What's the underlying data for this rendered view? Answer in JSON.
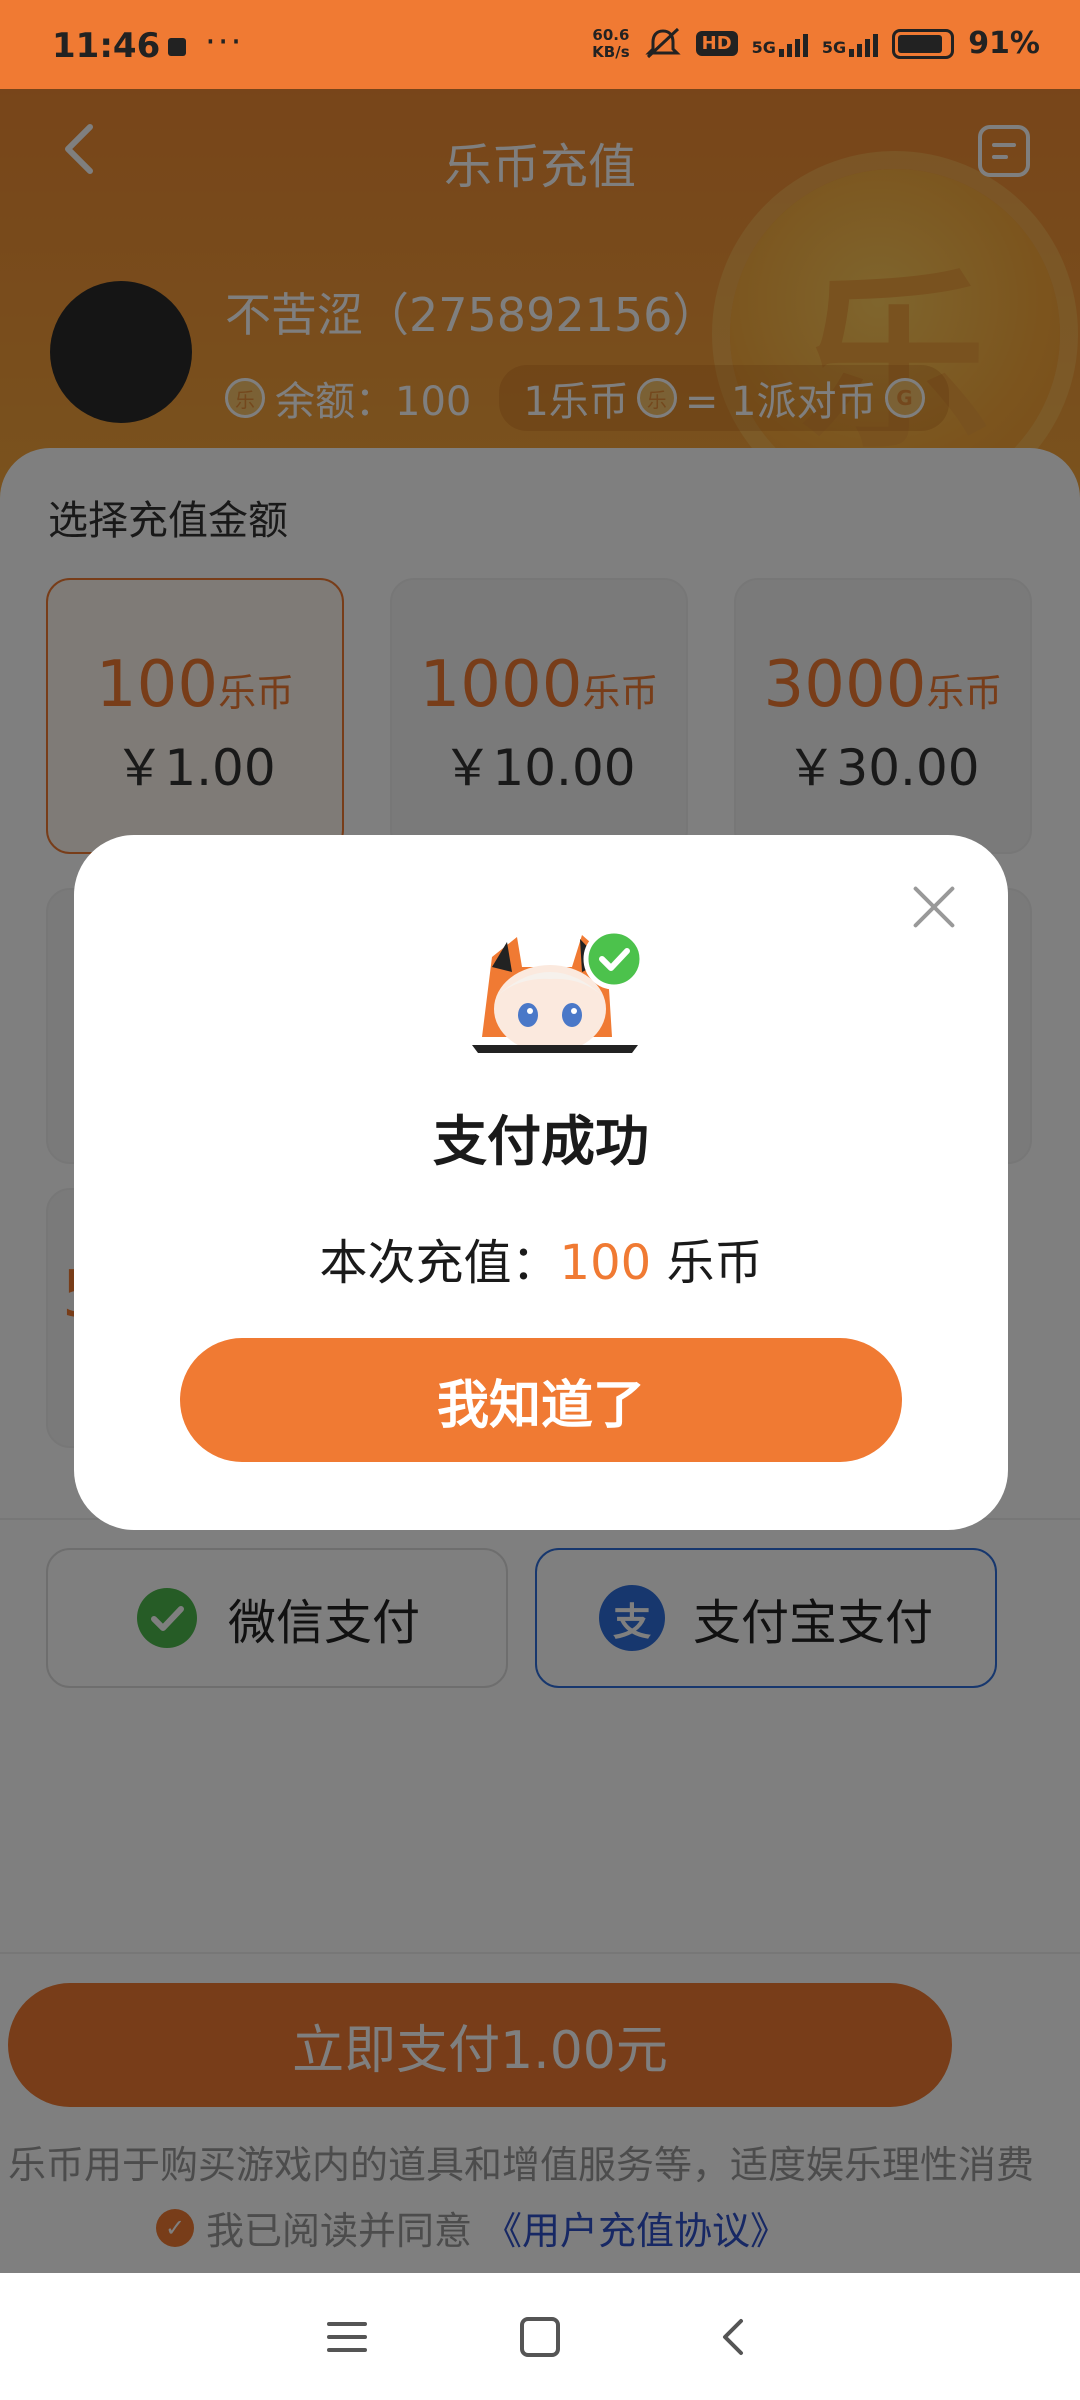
{
  "status_bar": {
    "time": "11:46",
    "more": "···",
    "net_speed_value": "60.6",
    "net_speed_unit": "KB/s",
    "hd": "HD",
    "sig1": "5G",
    "sig2": "5G",
    "battery_pct": "91%"
  },
  "header": {
    "title": "乐币充值",
    "username": "不苦涩（275892156）",
    "balance_label": "余额：100",
    "rate_left": "1乐币",
    "rate_right": "= 1派对币",
    "coin_symbol": "乐",
    "gcoin_symbol": "G"
  },
  "recharge": {
    "section_label": "选择充值金额",
    "options": [
      {
        "coins": "100",
        "unit": "乐币",
        "price": "￥1.00"
      },
      {
        "coins": "1000",
        "unit": "乐币",
        "price": "￥10.00"
      },
      {
        "coins": "3000",
        "unit": "乐币",
        "price": "￥30.00"
      }
    ],
    "partial_digit": "5"
  },
  "payment": {
    "wechat": "微信支付",
    "alipay": "支付宝支付",
    "alipay_icon": "支",
    "pay_button": "立即支付1.00元",
    "notice": "乐币用于购买游戏内的道具和增值服务等，适度娱乐理性消费",
    "agree_text": "我已阅读并同意",
    "agree_link": "《用户充值协议》"
  },
  "modal": {
    "title": "支付成功",
    "amount_prefix": "本次充值：",
    "amount_value": "100",
    "amount_unit": "乐币",
    "ok_button": "我知道了"
  },
  "colors": {
    "accent": "#f07a33",
    "link": "#2e50c8",
    "success": "#4cc24c"
  },
  "icons": [
    "back-icon",
    "menu-icon",
    "close-icon",
    "wechat-icon",
    "alipay-icon",
    "check-icon",
    "success-check-icon"
  ]
}
